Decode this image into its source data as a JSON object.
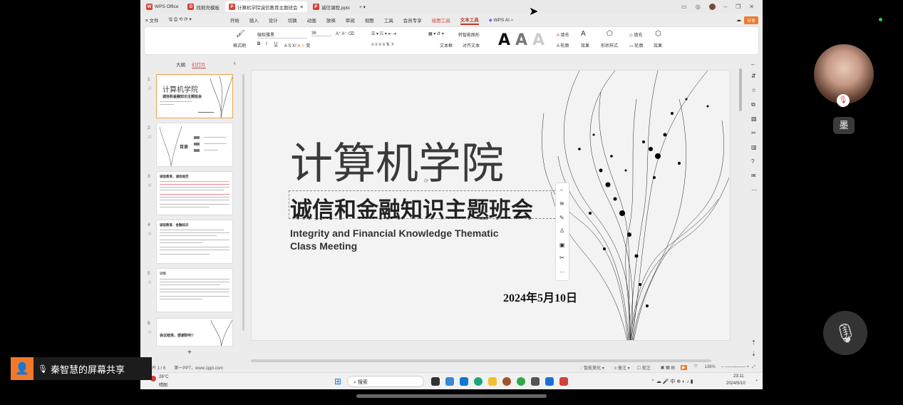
{
  "titlebar": {
    "tabs": [
      {
        "label": "WPS Office",
        "color": "#d0433b"
      },
      {
        "label": "找稻壳模板",
        "color": "#d0433b"
      },
      {
        "label": "计算机学院诚信教育主题班会",
        "color": "#d0433b"
      },
      {
        "label": "诚信课程.pptx",
        "color": "#d0433b"
      }
    ],
    "add": "+ ▾"
  },
  "menubar": {
    "file": "≡ 文件",
    "items": [
      "开始",
      "插入",
      "设计",
      "切换",
      "动画",
      "放映",
      "审阅",
      "视图",
      "工具",
      "会员专享"
    ],
    "red1": "绘图工具",
    "selected": "文本工具",
    "ai": "WPS AI",
    "share": "分享"
  },
  "ribbon": {
    "format_painter": "格式刷",
    "font": "微软雅黑",
    "size": "36",
    "smart_shape": "转智能图形",
    "text_box": "文本框",
    "align_text": "对齐文本",
    "fill": "填充",
    "outline": "轮廓",
    "effect": "效果",
    "shape_style": "形状样式",
    "fill2": "填充",
    "outline2": "轮廓",
    "effect2": "效果"
  },
  "leftpane": {
    "tab_outline": "大纲",
    "tab_slides": "幻灯片",
    "slide_nums": [
      "1",
      "2",
      "3",
      "4",
      "5",
      "6"
    ],
    "t1_title": "计算机学院",
    "t1_sub": "诚信和金融知识主题班会",
    "t2_title": "目录",
    "t3_title": "诚信教育、诚信规范",
    "t4_title": "诚信教育、金融知识",
    "t5_title": "讨论",
    "t6_title": "会议结束，感谢聆听！",
    "add": "+"
  },
  "slide": {
    "title": "计算机学院",
    "subtitle": "诚信和金融知识主题班会",
    "english1": "Integrity and Financial Knowledge Thematic",
    "english2": "Class Meeting",
    "date": "2024年5月10日"
  },
  "statusbar": {
    "page": "幻灯片 1 / 6",
    "theme": "第一PPT，www.1ppt.com",
    "beautify": "智能美化",
    "notes": "备注",
    "comment": "批注",
    "zoom": "136%"
  },
  "taskbar": {
    "weather_temp": "26°C",
    "weather_desc": "晴朗",
    "search": "搜索",
    "ime": "中",
    "time": "23:11",
    "date": "2024/5/10"
  },
  "overlay": {
    "share_label": "秦智慧的屏幕共享",
    "participant": "墨"
  }
}
